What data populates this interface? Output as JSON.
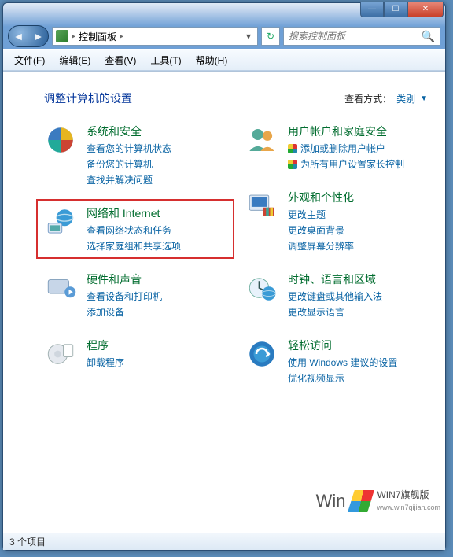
{
  "breadcrumb": {
    "label": "控制面板"
  },
  "search": {
    "placeholder": "搜索控制面板"
  },
  "menus": {
    "file": "文件(F)",
    "edit": "编辑(E)",
    "view": "查看(V)",
    "tools": "工具(T)",
    "help": "帮助(H)"
  },
  "page": {
    "title": "调整计算机的设置",
    "view_label": "查看方式：",
    "view_value": "类别"
  },
  "categories": {
    "left": [
      {
        "title": "系统和安全",
        "links": [
          "查看您的计算机状态",
          "备份您的计算机",
          "查找并解决问题"
        ]
      },
      {
        "title": "网络和 Internet",
        "links": [
          "查看网络状态和任务",
          "选择家庭组和共享选项"
        ],
        "highlight": true
      },
      {
        "title": "硬件和声音",
        "links": [
          "查看设备和打印机",
          "添加设备"
        ]
      },
      {
        "title": "程序",
        "links": [
          "卸载程序"
        ]
      }
    ],
    "right": [
      {
        "title": "用户帐户和家庭安全",
        "links_shield": [
          "添加或删除用户帐户",
          "为所有用户设置家长控制"
        ]
      },
      {
        "title": "外观和个性化",
        "links": [
          "更改主题",
          "更改桌面背景",
          "调整屏幕分辨率"
        ]
      },
      {
        "title": "时钟、语言和区域",
        "links": [
          "更改键盘或其他输入法",
          "更改显示语言"
        ]
      },
      {
        "title": "轻松访问",
        "links": [
          "使用 Windows 建议的设置",
          "优化视频显示"
        ]
      }
    ]
  },
  "status": {
    "text": "3 个项目"
  },
  "watermark": {
    "big": "Win",
    "small1": "WIN7旗舰版",
    "small2": "www.win7qijian.com"
  }
}
